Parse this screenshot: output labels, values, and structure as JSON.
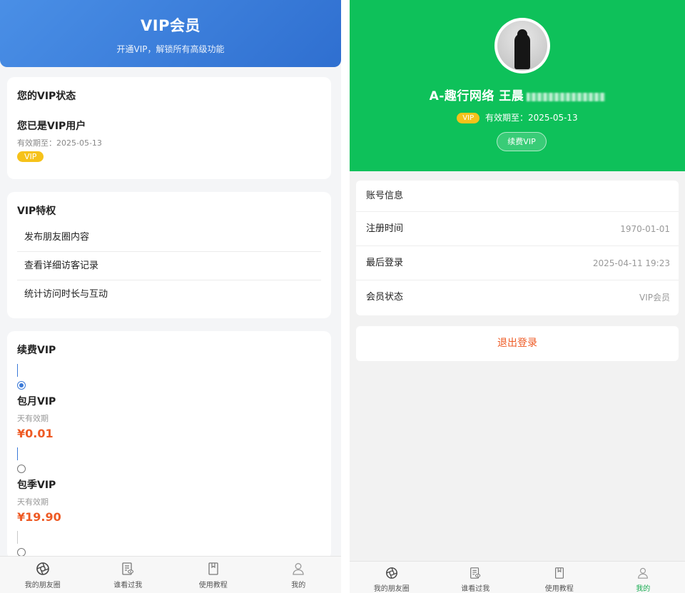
{
  "left": {
    "header": {
      "title": "VIP会员",
      "subtitle": "开通VIP，解锁所有高级功能"
    },
    "status": {
      "title": "您的VIP状态",
      "user_text": "您已是VIP用户",
      "expiry": "有效期至：2025-05-13",
      "badge": "VIP"
    },
    "privileges": {
      "title": "VIP特权",
      "items": [
        "发布朋友圈内容",
        "查看详细访客记录",
        "统计访问时长与互动"
      ]
    },
    "renew": {
      "title": "续费VIP",
      "plans": [
        {
          "name": "包月VIP",
          "valid": "天有效期",
          "price": "¥0.01",
          "selected": true
        },
        {
          "name": "包季VIP",
          "valid": "天有效期",
          "price": "¥19.90",
          "selected": false
        }
      ]
    },
    "tabs": [
      {
        "label": "我的朋友圈",
        "icon": "aperture-icon"
      },
      {
        "label": "谁看过我",
        "icon": "document-eye-icon"
      },
      {
        "label": "使用教程",
        "icon": "bookmark-icon"
      },
      {
        "label": "我的",
        "icon": "user-icon"
      }
    ]
  },
  "right": {
    "profile": {
      "username": "A-趣行网络 王晨",
      "vip_badge": "VIP",
      "expiry": "有效期至：2025-05-13",
      "renew_label": "续费VIP"
    },
    "account": {
      "title": "账号信息",
      "rows": [
        {
          "label": "注册时间",
          "value": "1970-01-01"
        },
        {
          "label": "最后登录",
          "value": "2025-04-11 19:23"
        },
        {
          "label": "会员状态",
          "value": "VIP会员"
        }
      ]
    },
    "logout_label": "退出登录",
    "tabs": [
      {
        "label": "我的朋友圈",
        "icon": "aperture-icon"
      },
      {
        "label": "谁看过我",
        "icon": "document-eye-icon"
      },
      {
        "label": "使用教程",
        "icon": "bookmark-icon"
      },
      {
        "label": "我的",
        "icon": "user-icon",
        "active": true
      }
    ]
  },
  "colors": {
    "left_header": "#3a79d8",
    "right_header": "#0ec15a",
    "vip_gold": "#f6c21a",
    "price_orange": "#ee5a24",
    "active_tab": "#1aad53"
  }
}
